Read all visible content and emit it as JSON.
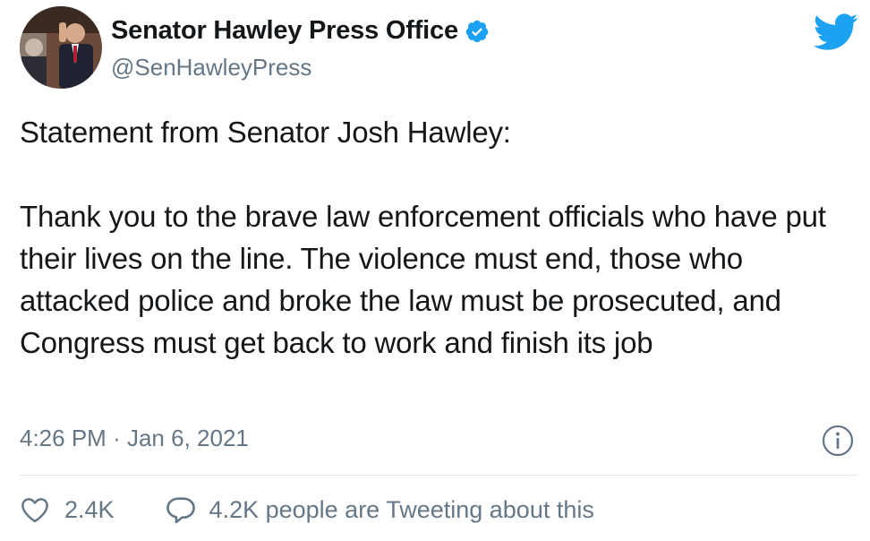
{
  "user": {
    "display_name": "Senator Hawley Press Office",
    "handle": "@SenHawleyPress",
    "verified": true
  },
  "tweet": {
    "text": "Statement from Senator Josh Hawley:\n\nThank you to the brave law enforcement officials who have put their lives on the line. The violence must end, those who attacked police and broke the law must be prosecuted, and Congress must get back to work and finish its job",
    "time": "4:26 PM",
    "separator": "·",
    "date": "Jan 6, 2021"
  },
  "actions": {
    "likes": "2.4K",
    "tweeting": "4.2K people are Tweeting about this"
  },
  "colors": {
    "twitter_blue": "#1da1f2",
    "secondary_text": "#657786",
    "primary_text": "#14171a",
    "divider": "#e1e8ed"
  },
  "icons": [
    "twitter-bird-icon",
    "verified-badge-icon",
    "info-icon",
    "heart-icon",
    "speech-bubble-icon"
  ]
}
